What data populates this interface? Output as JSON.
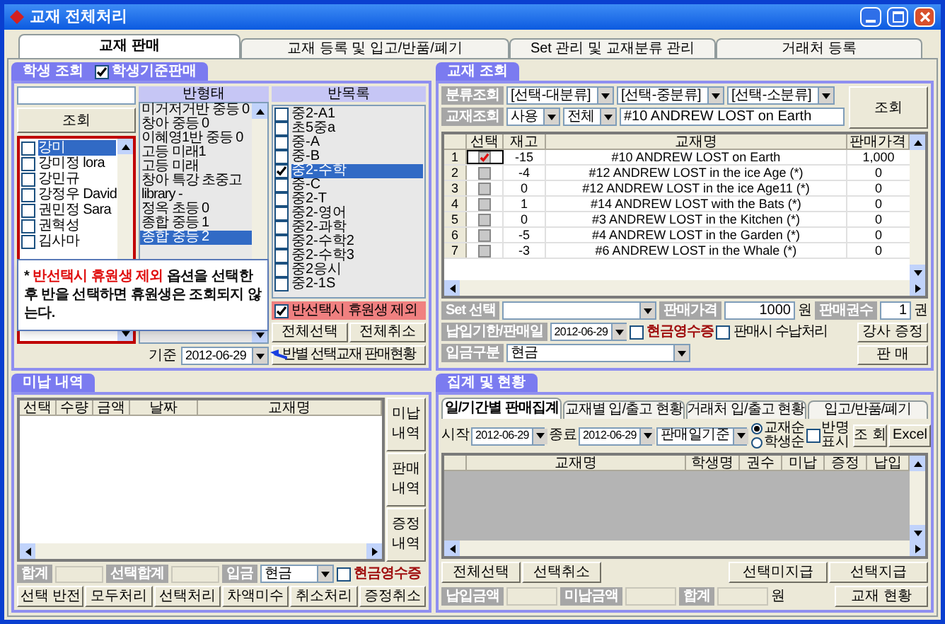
{
  "window": {
    "title": "교재 전체처리"
  },
  "tabs": [
    {
      "label": "교재 판매",
      "selected": true
    },
    {
      "label": "교재 등록 및 입고/반품/폐기",
      "selected": false
    },
    {
      "label": "Set 관리 및 교재분류 관리",
      "selected": false
    },
    {
      "label": "거래처 등록",
      "selected": false
    }
  ],
  "student_lookup": {
    "title": "학생 조회",
    "sell_by_student": {
      "label": "학생기준판매",
      "checked": true
    },
    "search_button": "조회",
    "students": [
      {
        "name": "강미",
        "checked": false,
        "selected": true
      },
      {
        "name": "강미정 lora",
        "checked": false,
        "selected": false
      },
      {
        "name": "강민규",
        "checked": false,
        "selected": false
      },
      {
        "name": "강정우 David",
        "checked": false,
        "selected": false
      },
      {
        "name": "권민정 Sara",
        "checked": false,
        "selected": false
      },
      {
        "name": "권혁성",
        "checked": false,
        "selected": false
      },
      {
        "name": "김사마",
        "checked": false,
        "selected": false
      }
    ],
    "class_types": {
      "title": "반형태",
      "items": [
        {
          "label": "미거저거반 중등 0",
          "selected": false
        },
        {
          "label": "창아 중등 0",
          "selected": false
        },
        {
          "label": "이혜영1반 중등 0",
          "selected": false
        },
        {
          "label": "고등 미래1",
          "selected": false
        },
        {
          "label": "고등 미래",
          "selected": false
        },
        {
          "label": "창아 특강 초중고",
          "selected": false
        },
        {
          "label": "library -",
          "selected": false
        },
        {
          "label": "정옥 초등 0",
          "selected": false
        },
        {
          "label": "종합 중등 1",
          "selected": false
        },
        {
          "label": "종합 중등 2",
          "selected": true
        }
      ]
    },
    "date_label": "기준",
    "date": "2012-06-29",
    "class_list": {
      "title": "반목록",
      "items": [
        {
          "label": "중2-A1",
          "checked": false,
          "selected": false
        },
        {
          "label": "초5중a",
          "checked": false,
          "selected": false
        },
        {
          "label": "중-A",
          "checked": false,
          "selected": false
        },
        {
          "label": "중-B",
          "checked": false,
          "selected": false
        },
        {
          "label": "중2-수학",
          "checked": true,
          "selected": true
        },
        {
          "label": "중-C",
          "checked": false,
          "selected": false
        },
        {
          "label": "중2-T",
          "checked": false,
          "selected": false
        },
        {
          "label": "중2-영어",
          "checked": false,
          "selected": false
        },
        {
          "label": "중2-과학",
          "checked": false,
          "selected": false
        },
        {
          "label": "중2-수학2",
          "checked": false,
          "selected": false
        },
        {
          "label": "중2-수학3",
          "checked": false,
          "selected": false
        },
        {
          "label": "중2응시",
          "checked": false,
          "selected": false
        },
        {
          "label": "중2-1S",
          "checked": false,
          "selected": false
        }
      ]
    },
    "exclude_inactive": {
      "label": "반선택시 휴원생 제외",
      "checked": true
    },
    "select_all_button": "전체선택",
    "clear_all_button": "전체취소",
    "class_sales_button": "반별 선택교재 판매현황"
  },
  "callout": {
    "text": "* **반선택시 휴원생 제외** 옵션을 선택한 후 반을 선택하면 휴원생은 조회되지 않는다."
  },
  "unpaid": {
    "title": "미납 내역",
    "columns": [
      "선택",
      "수량",
      "금액",
      "날짜",
      "교재명"
    ],
    "side_buttons": [
      "미납 내역",
      "판매 내역",
      "증정 내역"
    ],
    "total_label": "합계",
    "selected_total_label": "선택합계",
    "deposit_label": "입금",
    "deposit_method": "현금",
    "cash_receipt": {
      "label": "현금영수증",
      "checked": false
    },
    "buttons": [
      "선택 반전",
      "모두처리",
      "선택처리",
      "차액미수",
      "취소처리",
      "증정취소"
    ]
  },
  "book_lookup": {
    "title": "교재 조회",
    "category_label": "분류조회",
    "categories": [
      "[선택-대분류]",
      "[선택-중분류]",
      "[선택-소분류]"
    ],
    "search_button": "조회",
    "book_label": "교재조회",
    "usage": "사용",
    "scope": "전체",
    "book_query": "#10 ANDREW LOST on Earth",
    "columns": [
      "선택",
      "재고",
      "교재명",
      "판매가격"
    ],
    "rows": [
      {
        "no": "1",
        "checked": true,
        "stock": "-15",
        "title": "#10 ANDREW LOST on Earth",
        "price": "1,000"
      },
      {
        "no": "2",
        "checked": false,
        "stock": "-4",
        "title": "#12 ANDREW LOST in the ice Age (*)",
        "price": "0"
      },
      {
        "no": "3",
        "checked": false,
        "stock": "0",
        "title": "#12 ANDREW LOST in the ice Age11 (*)",
        "price": "0"
      },
      {
        "no": "4",
        "checked": false,
        "stock": "1",
        "title": "#14 ANDREW LOST with the Bats (*)",
        "price": "0"
      },
      {
        "no": "5",
        "checked": false,
        "stock": "0",
        "title": "#3 ANDREW LOST in the Kitchen (*)",
        "price": "0"
      },
      {
        "no": "6",
        "checked": false,
        "stock": "-5",
        "title": "#4 ANDREW LOST in the Garden (*)",
        "price": "0"
      },
      {
        "no": "7",
        "checked": false,
        "stock": "-3",
        "title": "#6 ANDREW LOST in the Whale (*)",
        "price": "0"
      }
    ],
    "set_label": "Set 선택",
    "price_label": "판매가격",
    "price": "1000",
    "price_unit": "원",
    "qty_label": "판매권수",
    "qty": "1",
    "qty_unit": "권",
    "due_label": "납입기한/판매일",
    "due_date": "2012-06-29",
    "cash_receipt": {
      "label": "현금영수증",
      "checked": false
    },
    "pay_on_sale": {
      "label": "판매시 수납처리",
      "checked": false
    },
    "gift_button": "강사 증정",
    "deposit_label": "입금구분",
    "deposit_method": "현금",
    "sell_button": "판 매"
  },
  "summary": {
    "title": "집계 및 현황",
    "tabs": [
      {
        "label": "일/기간별 판매집계",
        "selected": true
      },
      {
        "label": "교재별 입/출고 현황",
        "selected": false
      },
      {
        "label": "거래처 입/출고 현황",
        "selected": false
      },
      {
        "label": "입고/반품/폐기",
        "selected": false
      }
    ],
    "start_label": "시작",
    "start_date": "2012-06-29",
    "end_label": "종료",
    "end_date": "2012-06-29",
    "basis": "판매일기준",
    "sort": [
      {
        "label": "교재순",
        "selected": true
      },
      {
        "label": "학생순",
        "selected": false
      }
    ],
    "show_class": {
      "label": "반명 표시",
      "checked": false
    },
    "search_button": "조 회",
    "excel_button": "Excel",
    "columns": [
      "교재명",
      "학생명",
      "권수",
      "미납",
      "증정",
      "납입"
    ],
    "left_buttons": [
      "전체선택",
      "선택취소"
    ],
    "right_buttons": [
      "선택미지급",
      "선택지급"
    ],
    "paid_label": "납입금액",
    "unpaid_label": "미납금액",
    "total_label": "합계",
    "total_unit": "원",
    "status_button": "교재 현황"
  }
}
